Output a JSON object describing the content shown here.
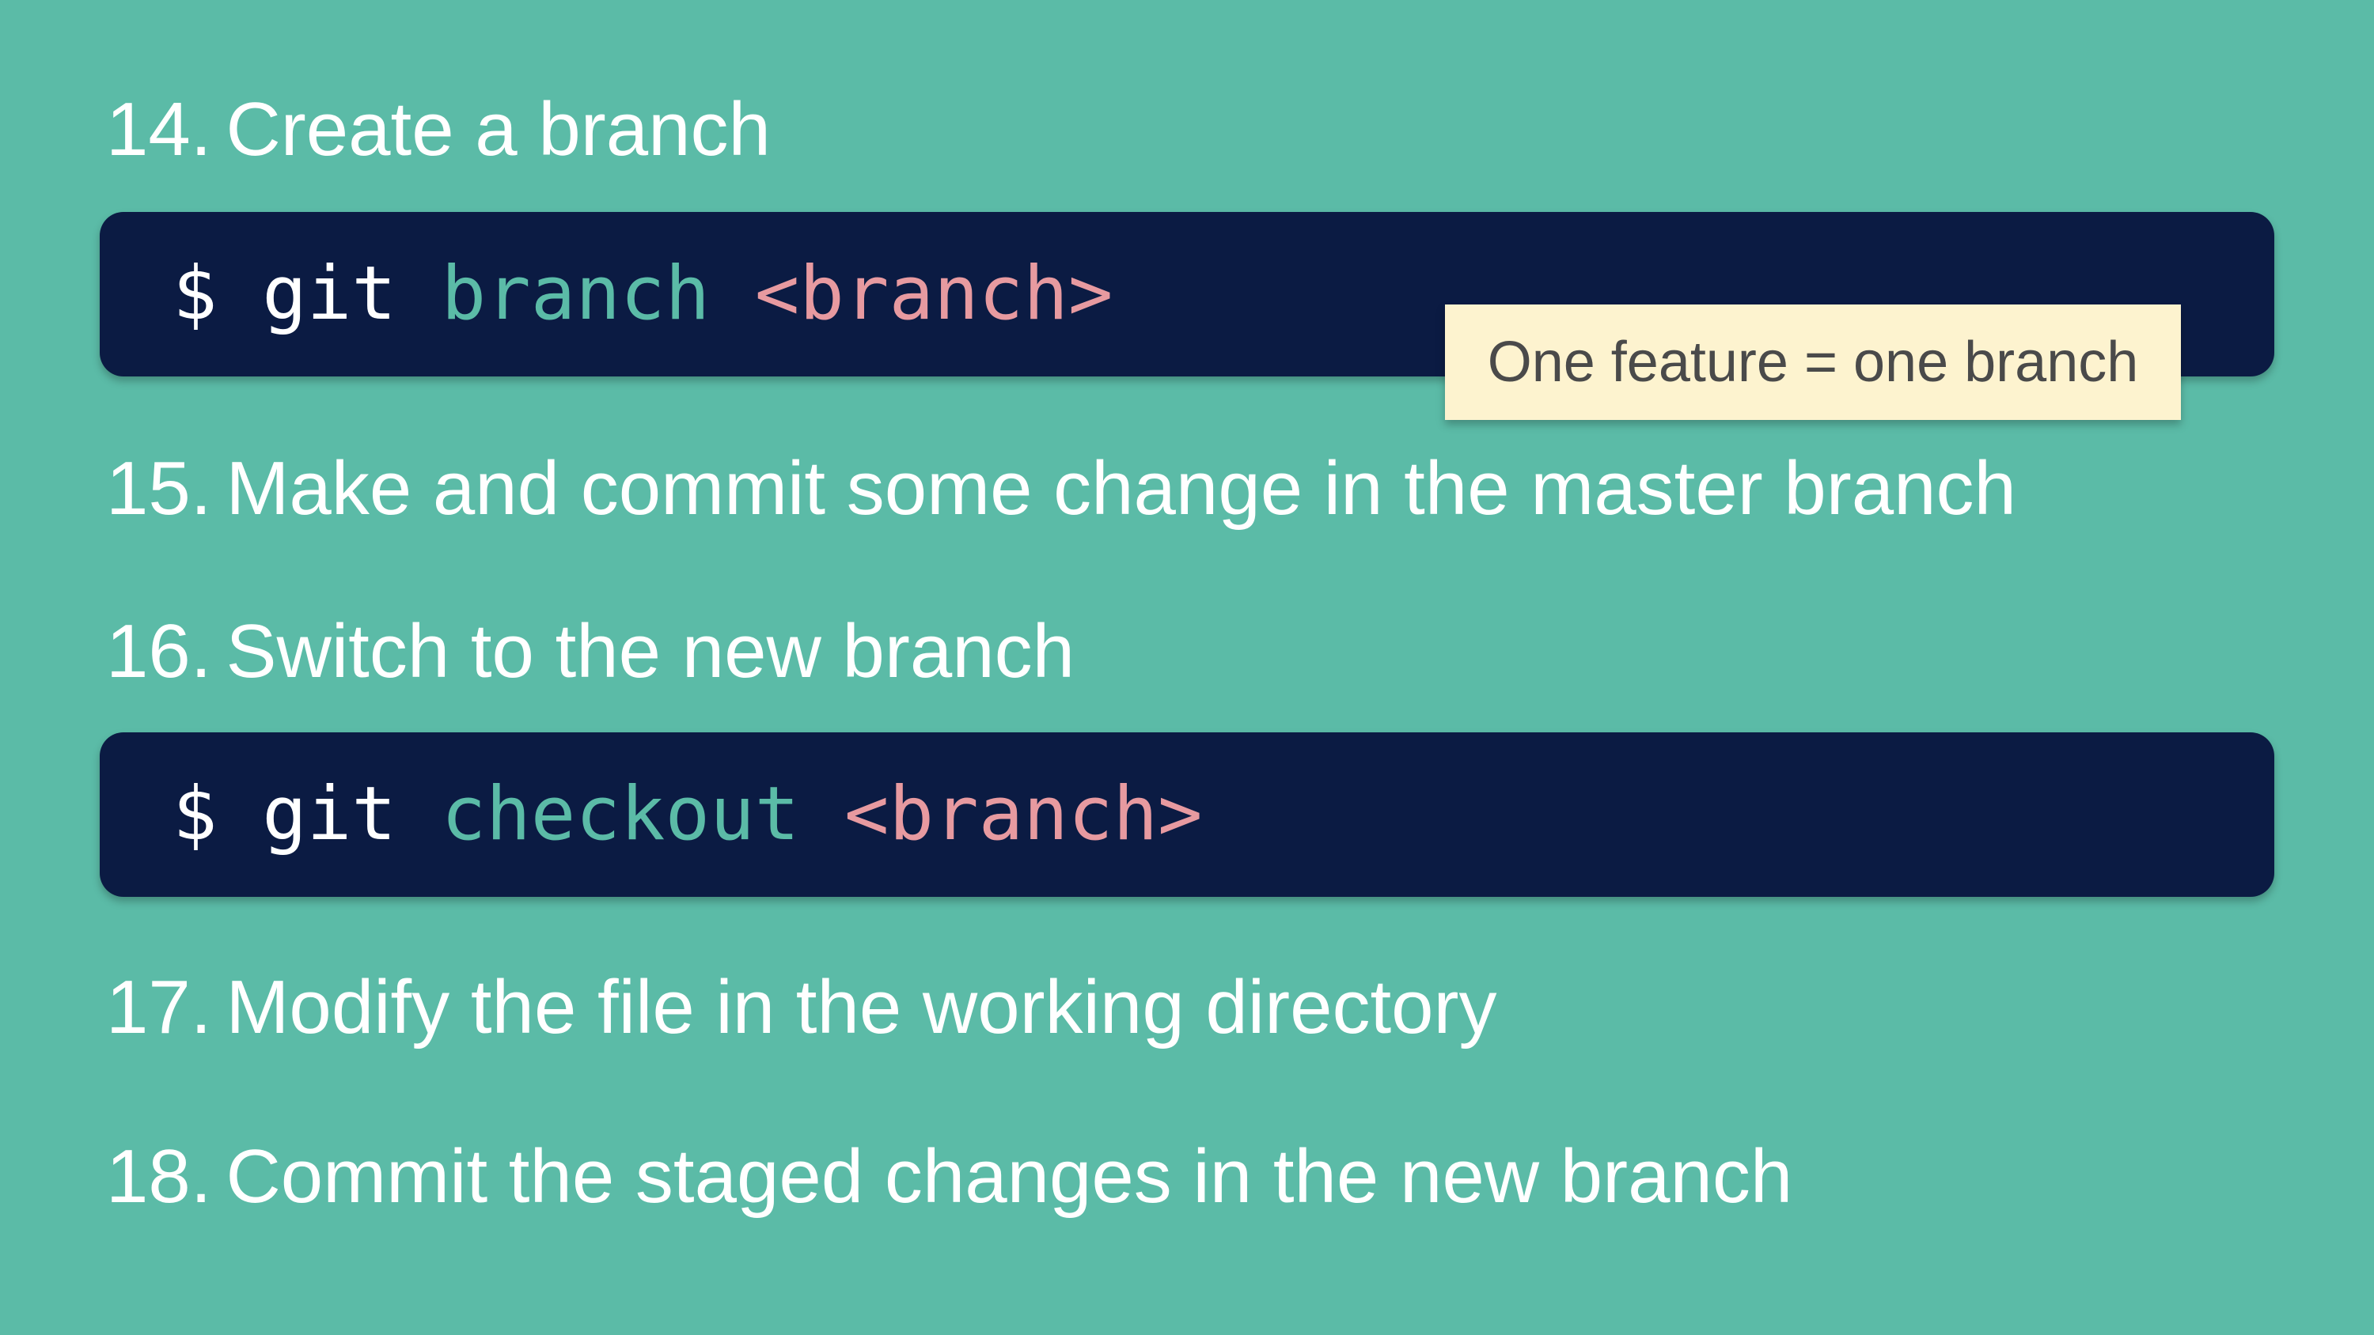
{
  "steps": [
    {
      "number": "14.",
      "text": "Create a branch"
    },
    {
      "number": "15.",
      "text": "Make and commit some change in the master branch"
    },
    {
      "number": "16.",
      "text": "Switch to the new branch"
    },
    {
      "number": "17.",
      "text": "Modify the file in the working directory"
    },
    {
      "number": "18.",
      "text": "Commit the staged changes in the new branch"
    }
  ],
  "code_blocks": [
    {
      "prompt": "$",
      "program": "git",
      "command": "branch",
      "argument": "<branch>"
    },
    {
      "prompt": "$",
      "program": "git",
      "command": "checkout",
      "argument": "<branch>"
    }
  ],
  "note": {
    "text": "One feature = one branch"
  },
  "colors": {
    "background": "#5bbba7",
    "code_background": "#0b1b43",
    "command": "#5bbba7",
    "argument": "#e79aa0",
    "note_background": "#fdf3cf"
  }
}
